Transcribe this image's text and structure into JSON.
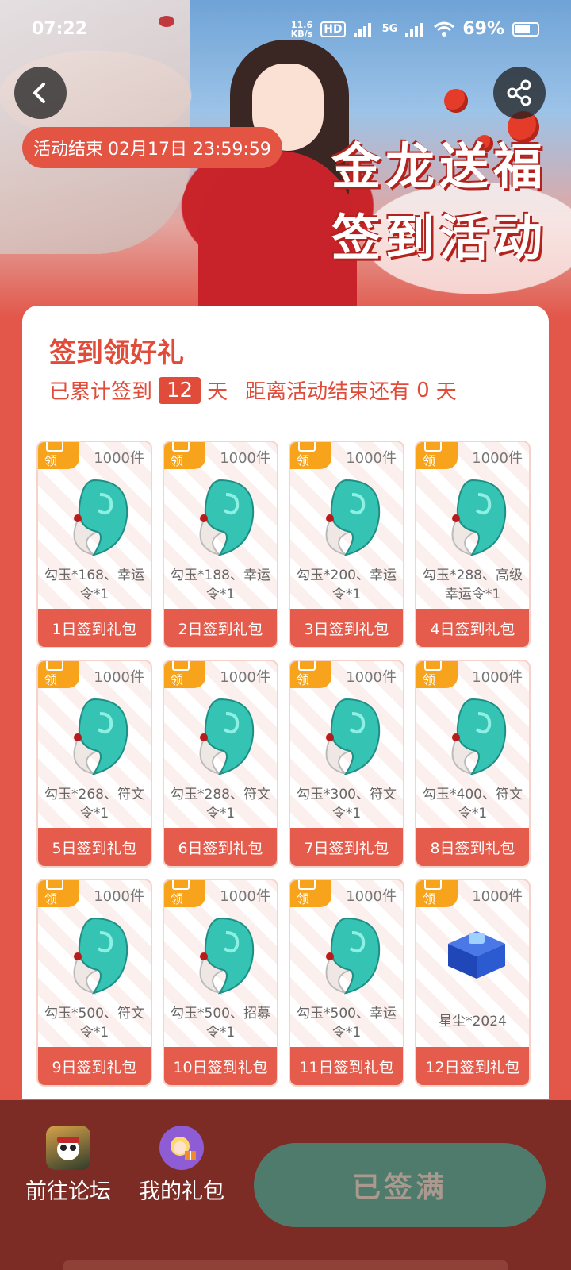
{
  "status_bar": {
    "time": "07:22",
    "net_speed_value": "11.6",
    "net_speed_unit": "KB/s",
    "hd_label": "HD",
    "network_label": "5G",
    "battery": "69%"
  },
  "banner": {
    "countdown_label": "活动结束",
    "countdown_time": "02月17日 23:59:59",
    "title_line1": "金龙送福",
    "title_line2": "签到活动",
    "back_icon": "chevron-left-icon",
    "share_icon": "share-icon"
  },
  "card": {
    "title": "签到领好礼",
    "progress_prefix": "已累计签到",
    "days_signed": "12",
    "days_unit": "天",
    "remaining_prefix": "距离活动结束还有",
    "days_remaining": "0",
    "remaining_unit": "天"
  },
  "gifts": [
    {
      "tag": "领",
      "stock": "1000件",
      "desc": "勾玉*168、幸运令*1",
      "name": "1日签到礼包",
      "icon": "magatama-icon"
    },
    {
      "tag": "领",
      "stock": "1000件",
      "desc": "勾玉*188、幸运令*1",
      "name": "2日签到礼包",
      "icon": "magatama-icon"
    },
    {
      "tag": "领",
      "stock": "1000件",
      "desc": "勾玉*200、幸运令*1",
      "name": "3日签到礼包",
      "icon": "magatama-icon"
    },
    {
      "tag": "领",
      "stock": "1000件",
      "desc": "勾玉*288、高级幸运令*1",
      "name": "4日签到礼包",
      "icon": "magatama-icon"
    },
    {
      "tag": "领",
      "stock": "1000件",
      "desc": "勾玉*268、符文令*1",
      "name": "5日签到礼包",
      "icon": "magatama-icon"
    },
    {
      "tag": "领",
      "stock": "1000件",
      "desc": "勾玉*288、符文令*1",
      "name": "6日签到礼包",
      "icon": "magatama-icon"
    },
    {
      "tag": "领",
      "stock": "1000件",
      "desc": "勾玉*300、符文令*1",
      "name": "7日签到礼包",
      "icon": "magatama-icon"
    },
    {
      "tag": "领",
      "stock": "1000件",
      "desc": "勾玉*400、符文令*1",
      "name": "8日签到礼包",
      "icon": "magatama-icon"
    },
    {
      "tag": "领",
      "stock": "1000件",
      "desc": "勾玉*500、符文令*1",
      "name": "9日签到礼包",
      "icon": "magatama-icon"
    },
    {
      "tag": "领",
      "stock": "1000件",
      "desc": "勾玉*500、招募令*1",
      "name": "10日签到礼包",
      "icon": "magatama-icon"
    },
    {
      "tag": "领",
      "stock": "1000件",
      "desc": "勾玉*500、幸运令*1",
      "name": "11日签到礼包",
      "icon": "magatama-icon"
    },
    {
      "tag": "领",
      "stock": "1000件",
      "desc": "星尘*2024",
      "name": "12日签到礼包",
      "icon": "stardust-chest-icon"
    }
  ],
  "bottom_bar": {
    "forum_label": "前往论坛",
    "forum_icon": "game-app-icon",
    "my_gifts_label": "我的礼包",
    "my_gifts_icon": "gift-avatar-icon",
    "signed_button": "已签满"
  },
  "colors": {
    "accent_red": "#e04b3a",
    "tag_orange": "#f7a41c",
    "bottom_bar_bg": "#7c2c24",
    "signed_button_bg": "#4e7b6b"
  }
}
